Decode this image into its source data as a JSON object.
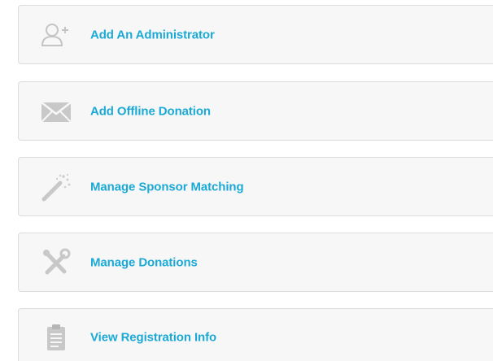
{
  "actions": [
    {
      "label": "Add An Administrator",
      "icon": "add-user-icon"
    },
    {
      "label": "Add Offline Donation",
      "icon": "envelope-icon"
    },
    {
      "label": "Manage Sponsor Matching",
      "icon": "magic-wand-icon"
    },
    {
      "label": "Manage Donations",
      "icon": "tools-icon"
    },
    {
      "label": "View Registration Info",
      "icon": "clipboard-icon"
    }
  ],
  "colors": {
    "link": "#1ba9d6",
    "icon": "#c8c8c8",
    "card_background": "#f7f7f7",
    "card_border": "#dcdcdc"
  }
}
